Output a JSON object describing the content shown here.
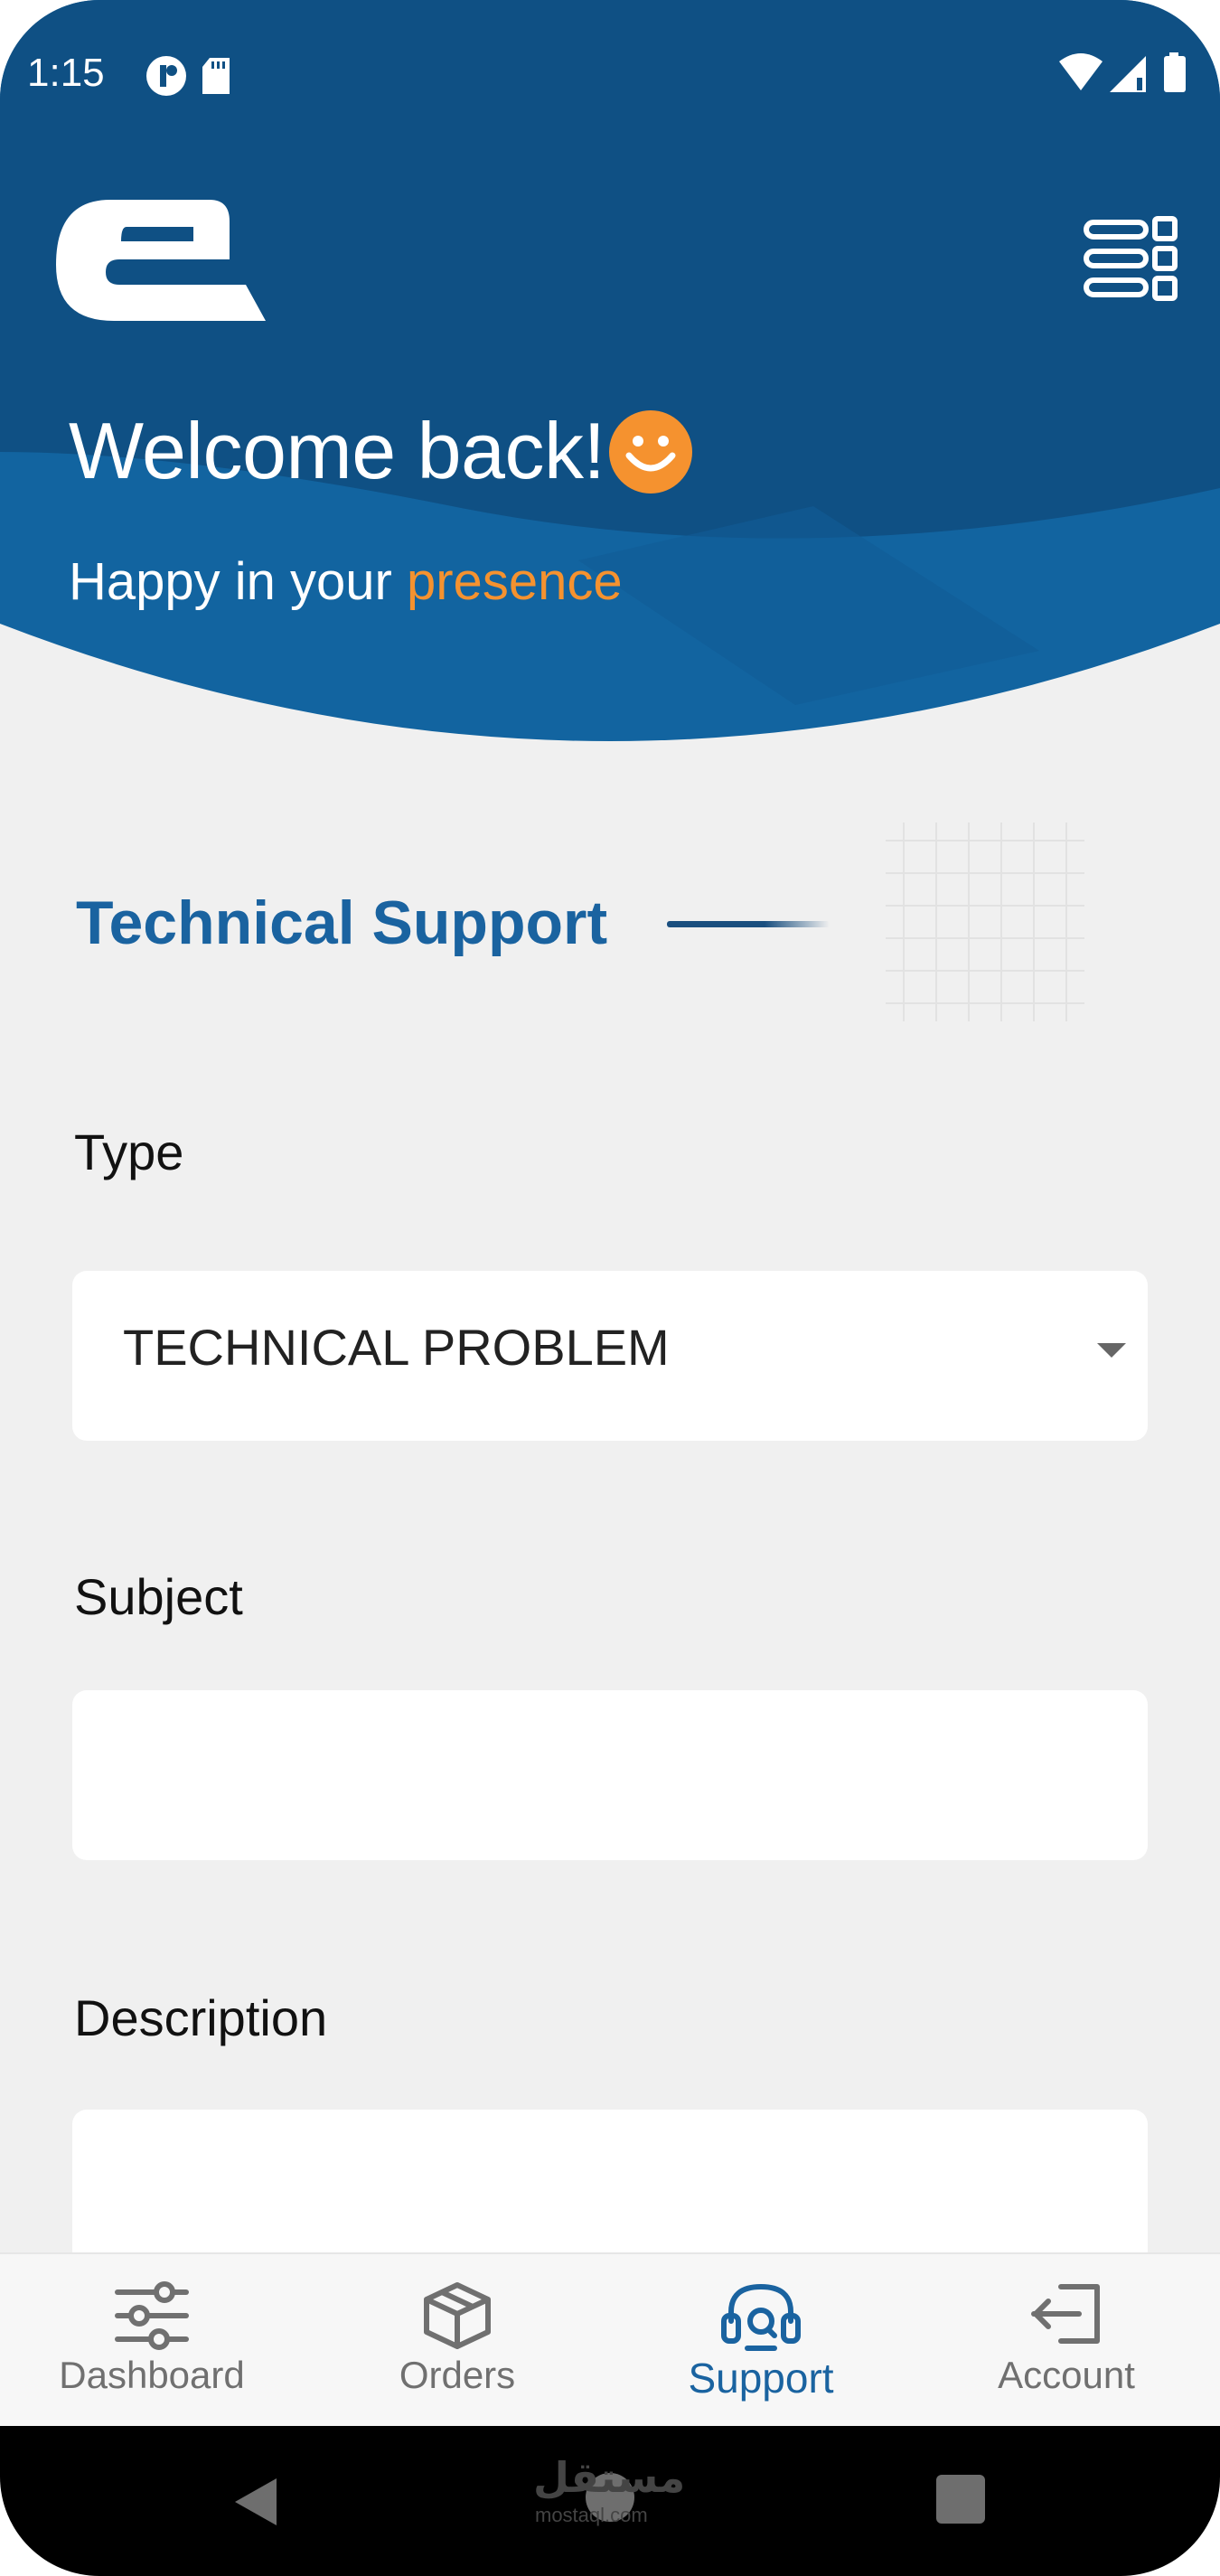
{
  "status_bar": {
    "time": "1:15",
    "left_icons": [
      "app-notification-icon",
      "sd-card-icon"
    ],
    "right_icons": [
      "wifi-icon",
      "signal-icon",
      "battery-icon"
    ]
  },
  "header": {
    "logo": "app-logo",
    "menu_icon": "grid-menu-icon",
    "welcome": "Welcome back!",
    "welcome_emoji": "smiley-icon",
    "tagline_prefix": "Happy in your ",
    "tagline_accent": "presence"
  },
  "section": {
    "title": "Technical Support"
  },
  "form": {
    "type_label": "Type",
    "type_value": "TECHNICAL PROBLEM",
    "subject_label": "Subject",
    "subject_value": "",
    "description_label": "Description",
    "description_value": ""
  },
  "bottom_nav": {
    "items": [
      {
        "label": "Dashboard",
        "icon": "sliders-icon"
      },
      {
        "label": "Orders",
        "icon": "box-icon"
      },
      {
        "label": "Support",
        "icon": "headset-icon",
        "active": true
      },
      {
        "label": "Account",
        "icon": "logout-icon"
      }
    ]
  },
  "system_nav": {
    "watermark": "مستقل",
    "watermark_sub": "mostaql.com"
  },
  "colors": {
    "primary": "#1a63a0",
    "header_dark": "#0f5084",
    "accent": "#f5922f",
    "background": "#f0f0f0"
  }
}
